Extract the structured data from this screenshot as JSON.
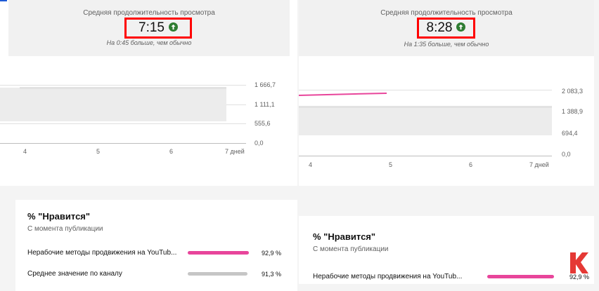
{
  "left_panel": {
    "stat_label": "Средняя продолжительность просмотра",
    "stat_value": "7:15",
    "stat_note": "На 0:45 больше, чем обычно",
    "y_ticks": [
      "1 666,7",
      "1 111,1",
      "555,6",
      "0,0"
    ],
    "x_ticks": [
      "4",
      "5",
      "6",
      "7 дней"
    ]
  },
  "right_panel": {
    "stat_label": "Средняя продолжительность просмотра",
    "stat_value": "8:28",
    "stat_note": "На 1:35 больше, чем обычно",
    "y_ticks": [
      "2 083,3",
      "1 388,9",
      "694,4",
      "0,0"
    ],
    "x_ticks": [
      "4",
      "5",
      "6",
      "7 дней"
    ]
  },
  "left_likes": {
    "title": "% \"Нравится\"",
    "subtitle": "С момента публикации",
    "rows": [
      {
        "label": "Нерабочие методы продвижения на YouTub...",
        "value": "92,9 %",
        "fill": 0.929
      },
      {
        "label": "Среднее значение по каналу",
        "value": "91,3 %",
        "fill": 0.913
      }
    ]
  },
  "right_likes": {
    "title": "% \"Нравится\"",
    "subtitle": "С момента публикации",
    "rows": [
      {
        "label": "Нерабочие методы продвижения на YouTub...",
        "value": "92,9 %",
        "fill": 0.929
      }
    ]
  },
  "colors": {
    "highlight": "#ff0000",
    "up_arrow": "#2e7d32",
    "primary_bar": "#e8459b",
    "secondary_bar": "#c6c6c6",
    "brand": "#e53935"
  },
  "icons": [
    "arrow-up-circle-icon",
    "k-logo-icon"
  ]
}
